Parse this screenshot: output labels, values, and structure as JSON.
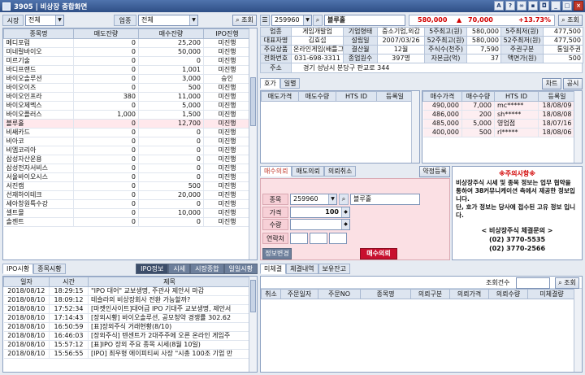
{
  "window": {
    "title": "3905 | 비상장 종합화면"
  },
  "filters": {
    "market_label": "시장",
    "market_value": "전체",
    "industry_label": "업종",
    "industry_value": "전체",
    "search_btn": "조회"
  },
  "stock_list": {
    "columns": [
      "종목명",
      "매도잔량",
      "매수잔량",
      "IPO진행"
    ],
    "rows": [
      [
        "메디포럼",
        "0",
        "25,200",
        "미진행"
      ],
      [
        "미네랄바이오",
        "0",
        "50,000",
        "미진행"
      ],
      [
        "미르기술",
        "0",
        "0",
        "미진행"
      ],
      [
        "바디프랜드",
        "0",
        "1,001",
        "미진행"
      ],
      [
        "바이오솔루션",
        "0",
        "3,000",
        "승인"
      ],
      [
        "바이오이즈",
        "0",
        "500",
        "미진행"
      ],
      [
        "바이오인프라",
        "380",
        "11,000",
        "미진행"
      ],
      [
        "바이오제멕스",
        "0",
        "5,000",
        "미진행"
      ],
      [
        "바이오플러스",
        "1,000",
        "1,500",
        "미진행"
      ],
      [
        "블루홀",
        "0",
        "12,700",
        "미진행"
      ],
      [
        "비쌔카드",
        "0",
        "0",
        "미진행"
      ],
      [
        "비아코",
        "0",
        "0",
        "미진행"
      ],
      [
        "비엠코리아",
        "0",
        "0",
        "미진행"
      ],
      [
        "삼성자산운용",
        "0",
        "0",
        "미진행"
      ],
      [
        "삼성전자서비스",
        "0",
        "0",
        "미진행"
      ],
      [
        "서울바이오시스",
        "0",
        "0",
        "미진행"
      ],
      [
        "서진캠",
        "0",
        "500",
        "미진행"
      ],
      [
        "선재하이테크",
        "0",
        "20,000",
        "미진행"
      ],
      [
        "세아창원특수강",
        "0",
        "0",
        "미진행"
      ],
      [
        "셀트몰",
        "0",
        "10,000",
        "미진행"
      ],
      [
        "솔젠트",
        "0",
        "0",
        "미진행"
      ]
    ]
  },
  "news": {
    "tabs": [
      "IPO시황",
      "종목시황"
    ],
    "right_tabs": [
      "IPO정보",
      "시세",
      "시장종합",
      "일일시황"
    ],
    "columns": [
      "일자",
      "시간",
      "제목"
    ],
    "rows": [
      [
        "2018/08/12",
        "18:29:15",
        "\"IPO 대어\" 교보생명, 주관사 제안서 마감"
      ],
      [
        "2018/08/10",
        "18:09:12",
        "테슬라의 비상장회사 전환 가능할까?"
      ],
      [
        "2018/08/10",
        "17:52:34",
        "[마켓인사이트]대어급 IPO 기대주 교보생명, 제안서"
      ],
      [
        "2018/08/10",
        "17:14:43",
        "[장외시황] 바이오솔루션, 공모청약 경쟁률 302.62"
      ],
      [
        "2018/08/10",
        "16:50:59",
        "[표]장외주식 거래현황(8/10)"
      ],
      [
        "2018/08/10",
        "16:46:03",
        "[장외주식] 텐센트가 2대주주에 오른 온라인 게임주"
      ],
      [
        "2018/08/10",
        "15:57:12",
        "[표]IPO 장외 주요 종목 시세(8월 10일)"
      ],
      [
        "2018/08/10",
        "15:56:55",
        "[IPO] 최우형 에이피티씨 사장 \"시총 100조 기업 만"
      ]
    ]
  },
  "quote": {
    "code": "259960",
    "name": "블루홀",
    "market_cap": "580,000",
    "arrow": "▲",
    "change": "70,000",
    "rate": "+13.73%",
    "search_btn": "조회",
    "info_rows": [
      [
        "업종",
        "게임개발업",
        "기업형태",
        "중소기업,외감",
        "5주최고(원)",
        "580,000",
        "5주최저(원)",
        "477,500"
      ],
      [
        "대표자명",
        "김효섭",
        "설립일",
        "2007/03/26",
        "52주최고(원)",
        "580,000",
        "52주최저(원)",
        "477,500"
      ],
      [
        "주요상품",
        "온라인게임(배틀그",
        "결산월",
        "12월",
        "주식수(천주)",
        "7,590",
        "주권구분",
        "통일주권"
      ],
      [
        "전화번호",
        "031-698-3311",
        "종업원수",
        "397명",
        "자본금(억)",
        "37",
        "액면가(원)",
        "500"
      ]
    ],
    "address_label": "주소",
    "address": "경기 성남시 분당구 판교로 344"
  },
  "orderbook": {
    "tabs": [
      "호가",
      "일별"
    ],
    "buttons": [
      "차트",
      "공시"
    ],
    "sell_columns": [
      "매도가격",
      "매도수량",
      "HTS ID",
      "등록일"
    ],
    "buy_columns": [
      "매수가격",
      "매수수량",
      "HTS ID",
      "등록일"
    ],
    "buy_rows": [
      [
        "490,000",
        "7,000",
        "mc*****",
        "18/08/09"
      ],
      [
        "486,000",
        "200",
        "sh*****",
        "18/08/08"
      ],
      [
        "485,000",
        "5,000",
        "영업점",
        "18/07/16"
      ],
      [
        "400,000",
        "500",
        "rl*****",
        "18/08/06"
      ]
    ]
  },
  "order": {
    "tabs": [
      "매수의뢰",
      "매도의뢰",
      "의뢰취소"
    ],
    "side_btn": "약정등록",
    "stock_label": "종목",
    "stock_code": "259960",
    "stock_name": "블루홀",
    "price_label": "가격",
    "price_value": "100",
    "qty_label": "수량",
    "contact_label": "연락처",
    "info_btn": "정보변경",
    "submit_btn": "매수의뢰"
  },
  "notice": {
    "title": "※주의사항※",
    "body": "비상장주식 시세 및 종목 정보는 업무 협약을 통하여 38커뮤니케이션 측에서 제공한 정보입니다.\n단, 호가 정보는 당사에 접수된 고유 정보 입니다.",
    "contact_title": "< 비상장주식 체결문의 >",
    "phone1": "(02) 3770-5535",
    "phone2": "(02) 3770-2566"
  },
  "executions": {
    "tabs": [
      "미체결",
      "체결내역",
      "보유잔고"
    ],
    "count_label": "조회건수",
    "search_btn": "조회",
    "columns": [
      "취소",
      "주문일자",
      "주문NO",
      "종목명",
      "의뢰구분",
      "의뢰가격",
      "의뢰수량",
      "미체결량"
    ]
  },
  "colors": {
    "title_bar": "#3a5a92",
    "up_red": "#d10000",
    "pink_order": "#fbe0e4"
  }
}
